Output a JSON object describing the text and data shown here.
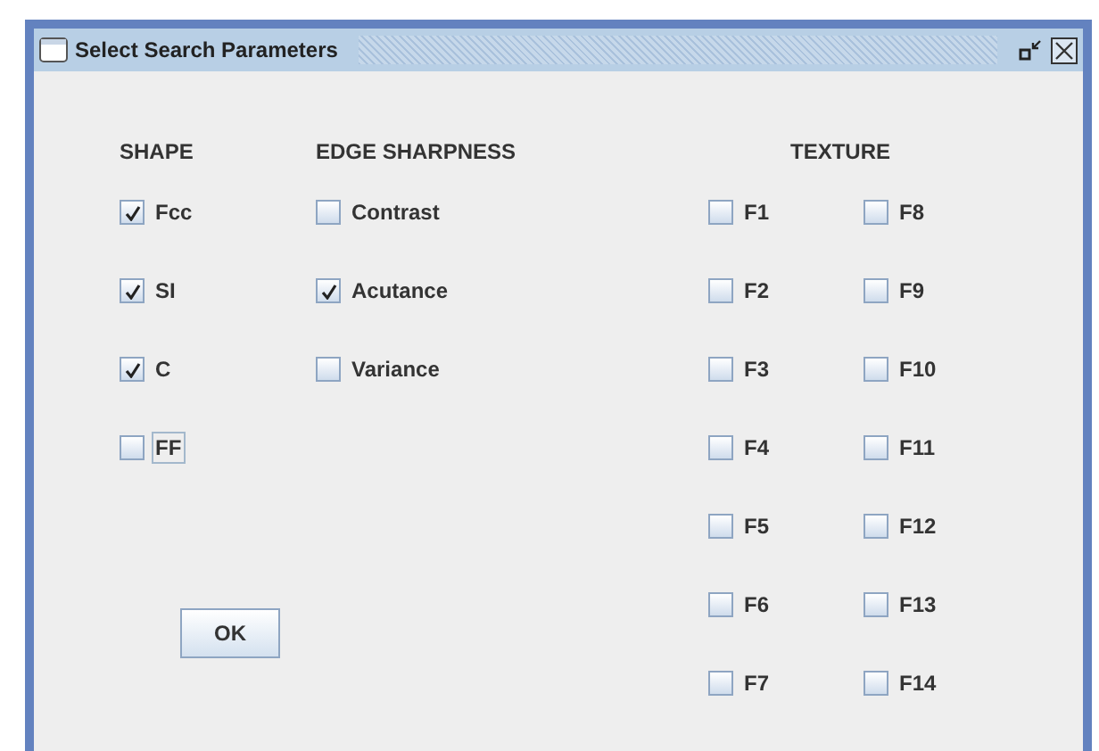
{
  "window": {
    "title": "Select Search Parameters"
  },
  "groups": [
    {
      "heading": "SHAPE",
      "items": [
        {
          "label": "Fcc",
          "checked": true,
          "focused": false
        },
        {
          "label": "SI",
          "checked": true,
          "focused": false
        },
        {
          "label": "C",
          "checked": true,
          "focused": false
        },
        {
          "label": "FF",
          "checked": false,
          "focused": true
        }
      ]
    },
    {
      "heading": "EDGE SHARPNESS",
      "items": [
        {
          "label": "Contrast",
          "checked": false,
          "focused": false
        },
        {
          "label": "Acutance",
          "checked": true,
          "focused": false
        },
        {
          "label": "Variance",
          "checked": false,
          "focused": false
        }
      ]
    },
    {
      "heading": "TEXTURE",
      "items": [
        {
          "label": "F1",
          "checked": false,
          "focused": false
        },
        {
          "label": "F2",
          "checked": false,
          "focused": false
        },
        {
          "label": "F3",
          "checked": false,
          "focused": false
        },
        {
          "label": "F4",
          "checked": false,
          "focused": false
        },
        {
          "label": "F5",
          "checked": false,
          "focused": false
        },
        {
          "label": "F6",
          "checked": false,
          "focused": false
        },
        {
          "label": "F7",
          "checked": false,
          "focused": false
        },
        {
          "label": "F8",
          "checked": false,
          "focused": false
        },
        {
          "label": "F9",
          "checked": false,
          "focused": false
        },
        {
          "label": "F10",
          "checked": false,
          "focused": false
        },
        {
          "label": "F11",
          "checked": false,
          "focused": false
        },
        {
          "label": "F12",
          "checked": false,
          "focused": false
        },
        {
          "label": "F13",
          "checked": false,
          "focused": false
        },
        {
          "label": "F14",
          "checked": false,
          "focused": false
        }
      ]
    }
  ],
  "buttons": [
    {
      "label": "OK"
    }
  ]
}
